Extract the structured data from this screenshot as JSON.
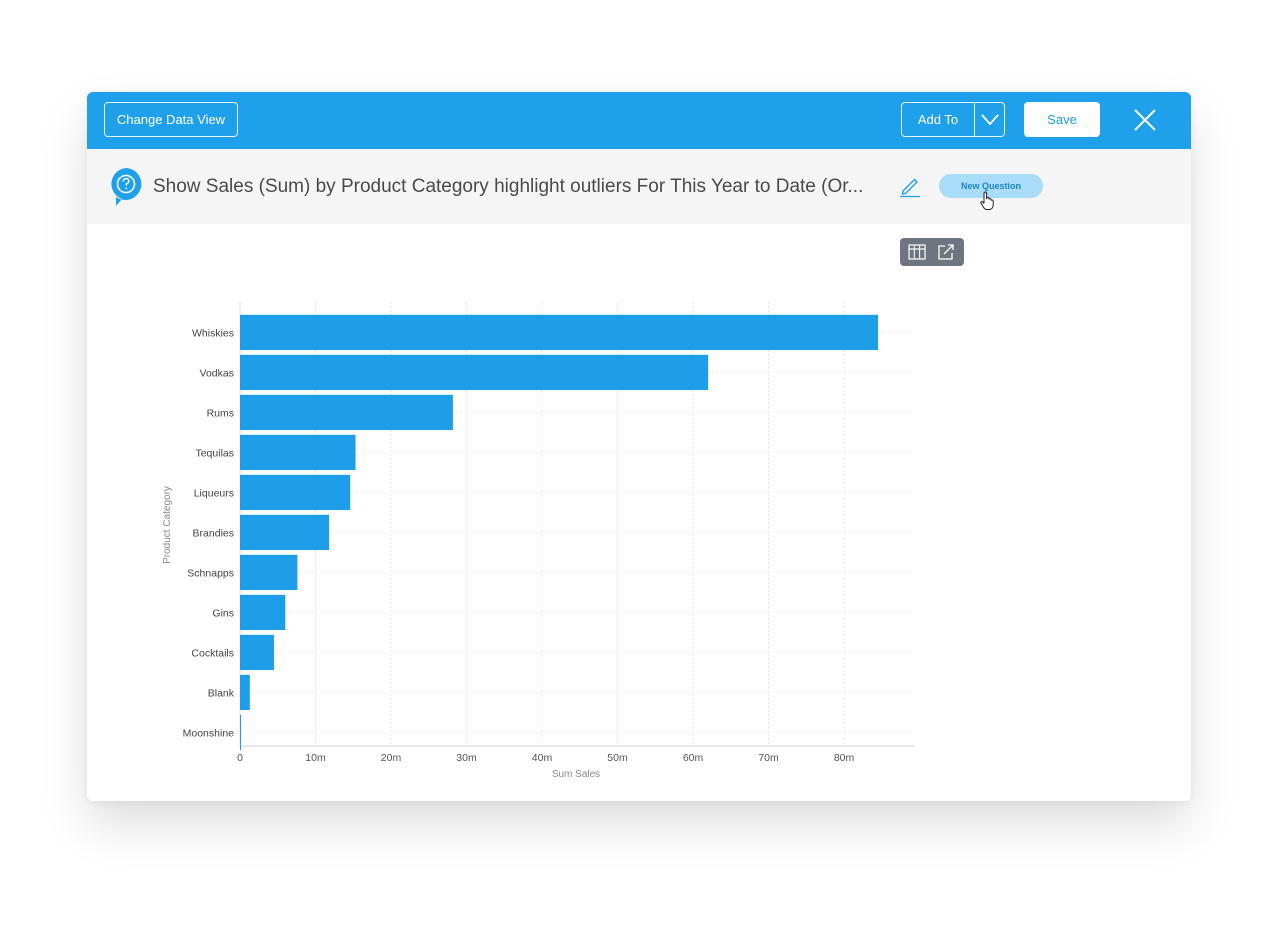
{
  "topbar": {
    "change_view_label": "Change Data View",
    "add_to_label": "Add To",
    "save_label": "Save"
  },
  "question": {
    "text": "Show Sales (Sum) by Product Category highlight outliers For This Year to Date (Or...",
    "new_question_label": "New Question"
  },
  "colors": {
    "accent": "#1ea0ea",
    "bar": "#1e9de8",
    "question_bar_bg": "#f5f5f5"
  },
  "icons": {
    "question": "question-bubble-icon",
    "edit": "pencil-icon",
    "close": "close-icon",
    "caret": "chevron-down-icon",
    "table": "table-icon",
    "export": "external-link-icon",
    "cursor": "hand-pointer-icon"
  },
  "chart_data": {
    "type": "bar",
    "orientation": "horizontal",
    "categories": [
      "Whiskies",
      "Vodkas",
      "Rums",
      "Tequilas",
      "Liqueurs",
      "Brandies",
      "Schnapps",
      "Gins",
      "Cocktails",
      "Blank",
      "Moonshine"
    ],
    "values": [
      84.5,
      62,
      28.2,
      15.3,
      14.6,
      11.8,
      7.6,
      6,
      4.5,
      1.3,
      0.1
    ],
    "value_unit": "millions",
    "xlabel": "Sum Sales",
    "ylabel": "Product Category",
    "xticks": [
      "0",
      "10m",
      "20m",
      "30m",
      "40m",
      "50m",
      "60m",
      "70m",
      "80m"
    ],
    "xlim": [
      0,
      89
    ],
    "grid": true,
    "legend": "none"
  }
}
